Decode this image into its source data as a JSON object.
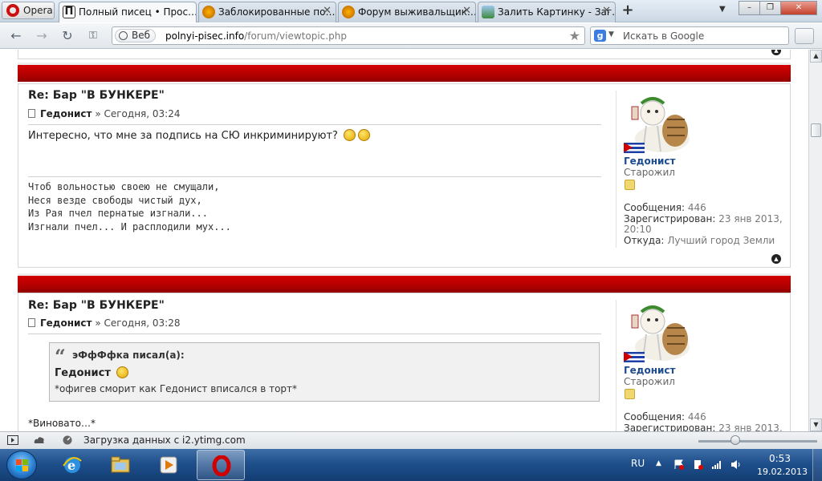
{
  "browser": {
    "menu_label": "Opera",
    "tabs": [
      {
        "title": "Полный писец • Прос…"
      },
      {
        "title": "Заблокированные по…"
      },
      {
        "title": "Форум выживальщик…"
      },
      {
        "title": "Залить Картинку - Заг…"
      }
    ],
    "new_tab": "+",
    "address": {
      "badge": "Веб",
      "host": "polnyi-pisec.info",
      "path": "/forum/viewtopic.php"
    },
    "search": {
      "engine_letter": "g",
      "placeholder": "Искать в Google"
    }
  },
  "posts": [
    {
      "title": "Re: Бар \"В БУНКЕРЕ\"",
      "author": "Гедонист",
      "time": "» Сегодня, 03:24",
      "text": "Интересно, что мне за подпись на СЮ инкриминируют?",
      "signature": [
        "Чтоб вольностью своею не смущали,",
        "Неся везде свободы чистый дух,",
        "Из Рая пчел пернатые изгнали...",
        "Изгнали пчел... И расплодили мух..."
      ],
      "profile": {
        "username": "Гедонист",
        "rank": "Старожил",
        "messages_label": "Сообщения:",
        "messages": "446",
        "registered_label": "Зарегистрирован:",
        "registered": "23 янв 2013,",
        "registered_time": "20:10",
        "from_label": "Откуда:",
        "from": "Лучший город Земли"
      }
    },
    {
      "title": "Re: Бар \"В БУНКЕРЕ\"",
      "author": "Гедонист",
      "time": "» Сегодня, 03:28",
      "quote": {
        "header": "эФфФфка писал(а):",
        "name": "Гедонист",
        "text": "*офигев сморит как Гедонист вписался в торт*"
      },
      "text": "*Виновато…*",
      "profile": {
        "username": "Гедонист",
        "rank": "Старожил",
        "messages_label": "Сообщения:",
        "messages": "446",
        "registered_label": "Зарегистрирован:",
        "registered": "23 янв 2013,"
      }
    }
  ],
  "statusbar": {
    "text": "Загрузка данных с i2.ytimg.com"
  },
  "taskbar": {
    "lang": "RU",
    "time": "0:53",
    "date": "19.02.2013"
  },
  "colors": {
    "post_header_red": "#b10000",
    "username_blue": "#1d4b8f"
  }
}
